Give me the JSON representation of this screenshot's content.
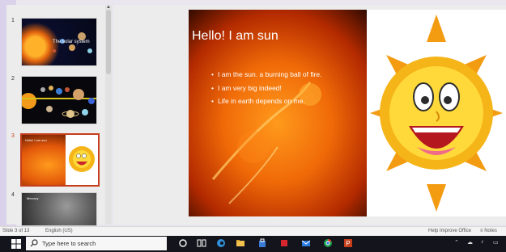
{
  "slides_panel": {
    "thumbnails": [
      {
        "number": "1",
        "title": "The solar system"
      },
      {
        "number": "2",
        "title": ""
      },
      {
        "number": "3",
        "title": "Hello! I am sun"
      },
      {
        "number": "4",
        "title": "Mercury"
      }
    ]
  },
  "current_slide": {
    "title": "Hello! I am sun",
    "bullets": [
      "I am the sun. a burning ball of fire.",
      "I am very big indeed!",
      "Life in earth depends on me."
    ]
  },
  "status_bar": {
    "slide_counter": "Slide 3 of 13",
    "language": "English (US)",
    "help_improve": "Help Improve Office",
    "notes_label": "Notes"
  },
  "taskbar": {
    "search_placeholder": "Type here to search"
  },
  "colors": {
    "selected_thumb_border": "#c43e1c",
    "taskbar_bg": "#14141c"
  }
}
